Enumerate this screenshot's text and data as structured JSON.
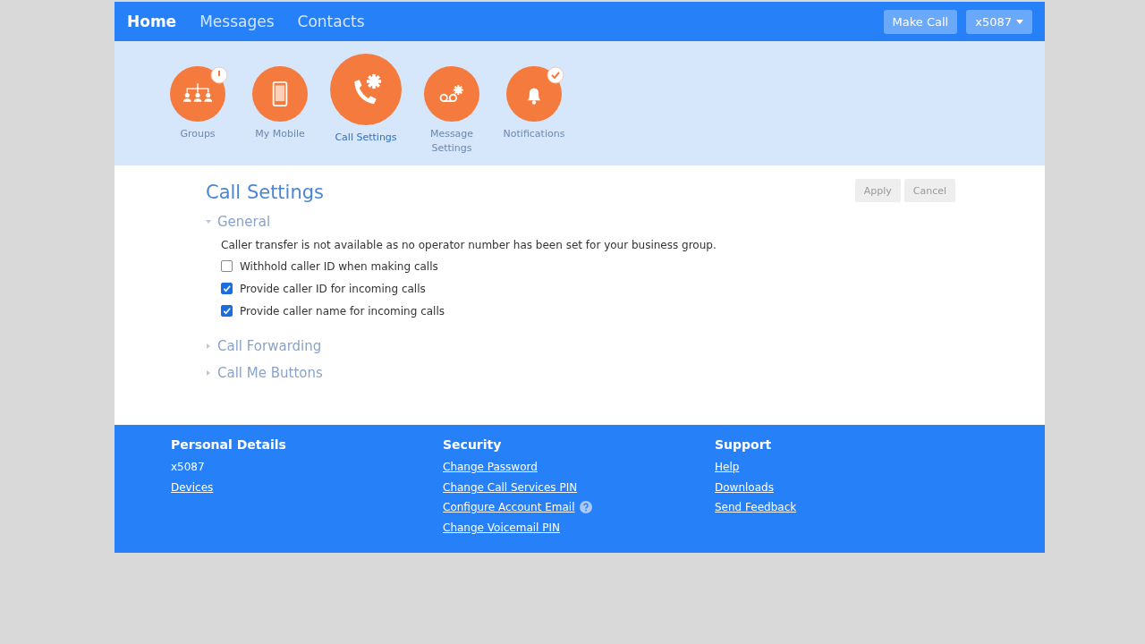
{
  "nav": {
    "links": [
      {
        "label": "Home",
        "selected": true
      },
      {
        "label": "Messages",
        "selected": false
      },
      {
        "label": "Contacts",
        "selected": false
      }
    ],
    "make_call": "Make Call",
    "account": "x5087"
  },
  "shortcuts": [
    {
      "label": "Groups",
      "kind": "groups",
      "badge": {
        "kind": "clock"
      },
      "selected": false
    },
    {
      "label": "My Mobile",
      "kind": "mobile",
      "selected": false
    },
    {
      "label": "Call Settings",
      "kind": "callsettings",
      "selected": true
    },
    {
      "label": "Message Settings",
      "kind": "voicemail",
      "selected": false
    },
    {
      "label": "Notifications",
      "kind": "bell",
      "badge": {
        "kind": "check"
      },
      "selected": false
    }
  ],
  "page_title": "Call Settings",
  "actions": [
    {
      "label": "Apply",
      "disabled": true
    },
    {
      "label": "Cancel",
      "disabled": true
    }
  ],
  "sections": [
    {
      "title": "General",
      "expanded": true,
      "note": "Caller transfer is not available as no operator number has been set for your business group.",
      "options": [
        {
          "label": "Withhold caller ID when making calls",
          "checked": false
        },
        {
          "label": "Provide caller ID for incoming calls",
          "checked": true
        },
        {
          "label": "Provide caller name for incoming calls",
          "checked": true
        }
      ]
    },
    {
      "title": "Call Forwarding",
      "expanded": false
    },
    {
      "title": "Call Me Buttons",
      "expanded": false
    }
  ],
  "footer": [
    {
      "heading": "Personal Details",
      "items": [
        {
          "kind": "text",
          "label": "x5087"
        },
        {
          "kind": "link",
          "label": "Devices"
        }
      ]
    },
    {
      "heading": "Security",
      "items": [
        {
          "kind": "link",
          "label": "Change Password"
        },
        {
          "kind": "link",
          "label": "Change Call Services PIN"
        },
        {
          "kind": "link",
          "label": "Configure Account Email",
          "help": true
        },
        {
          "kind": "link",
          "label": "Change Voicemail PIN"
        }
      ]
    },
    {
      "heading": "Support",
      "items": [
        {
          "kind": "link",
          "label": "Help"
        },
        {
          "kind": "link",
          "label": "Downloads"
        },
        {
          "kind": "link",
          "label": "Send Feedback"
        }
      ]
    }
  ]
}
